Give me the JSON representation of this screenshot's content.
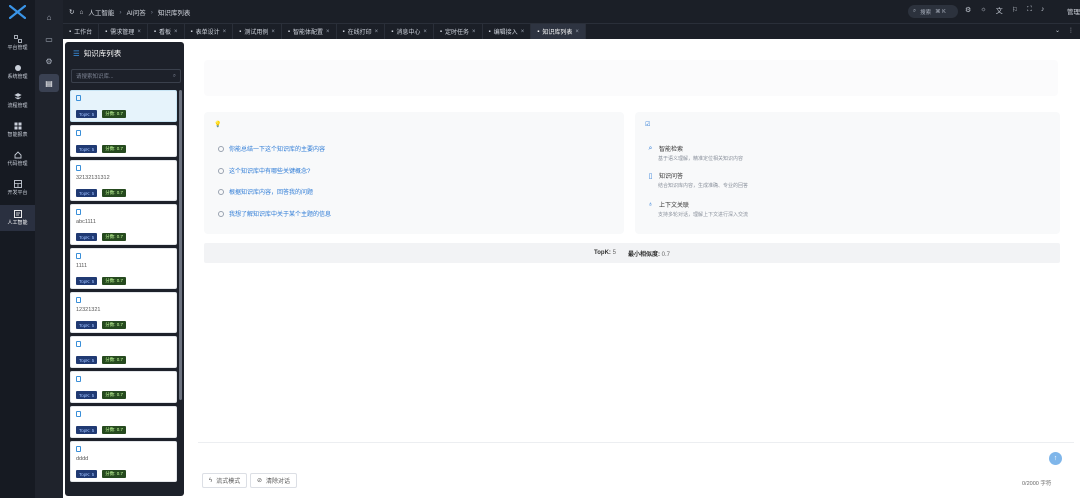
{
  "nav": {
    "items": [
      {
        "label": "平台管理",
        "icon": "platform-icon"
      },
      {
        "label": "系统管理",
        "icon": "system-icon"
      },
      {
        "label": "流程管理",
        "icon": "flow-icon"
      },
      {
        "label": "智能报表",
        "icon": "report-icon"
      },
      {
        "label": "代码管理",
        "icon": "code-icon"
      },
      {
        "label": "开发平台",
        "icon": "dev-icon"
      },
      {
        "label": "人工智能",
        "icon": "ai-icon"
      }
    ]
  },
  "breadcrumb": {
    "home": "⌂",
    "level1": "人工智能",
    "level2": "AI问答",
    "level3": "知识库列表"
  },
  "topbar": {
    "search_placeholder": "搜索",
    "search_shortcut": "⌘ K",
    "user": "管理"
  },
  "tabs": [
    {
      "label": "工作台",
      "active": false
    },
    {
      "label": "需求管理",
      "active": false
    },
    {
      "label": "看板",
      "active": false
    },
    {
      "label": "表单设计",
      "active": false
    },
    {
      "label": "测试用例",
      "active": false
    },
    {
      "label": "智能体配置",
      "active": false
    },
    {
      "label": "在线打印",
      "active": false
    },
    {
      "label": "消息中心",
      "active": false
    },
    {
      "label": "定时任务",
      "active": false
    },
    {
      "label": "编辑接入",
      "active": false
    },
    {
      "label": "知识库列表",
      "active": true
    }
  ],
  "knowledge_panel": {
    "title": "知识库列表",
    "search_placeholder": "请搜索知识库...",
    "items": [
      {
        "name": "",
        "topk": "TopK: 5",
        "score": "分数: 0.7",
        "selected": true
      },
      {
        "name": "",
        "topk": "TopK: 5",
        "score": "分数: 0.7",
        "selected": false
      },
      {
        "name": "32132131312",
        "topk": "TopK: 5",
        "score": "分数: 0.7",
        "selected": false
      },
      {
        "name": "abc1111",
        "topk": "TopK: 5",
        "score": "分数: 0.7",
        "selected": false
      },
      {
        "name": "1111",
        "topk": "TopK: 5",
        "score": "分数: 0.7",
        "selected": false
      },
      {
        "name": "12321321",
        "topk": "TopK: 5",
        "score": "分数: 0.7",
        "selected": false
      },
      {
        "name": "",
        "topk": "TopK: 5",
        "score": "分数: 0.7",
        "selected": false
      },
      {
        "name": "",
        "topk": "TopK: 5",
        "score": "分数: 0.7",
        "selected": false
      },
      {
        "name": "",
        "topk": "TopK: 5",
        "score": "分数: 0.7",
        "selected": false
      },
      {
        "name": "dddd",
        "topk": "TopK: 5",
        "score": "分数: 0.7",
        "selected": false
      }
    ]
  },
  "main": {
    "questions": [
      "你能总结一下这个知识库的主要内容",
      "这个知识库中有哪些关键概念?",
      "根据知识库内容，回答我的问题",
      "我想了解知识库中关于某个主题的信息"
    ],
    "features": [
      {
        "title": "智能检索",
        "desc": "基于语义理解，精准定位相关知识内容",
        "icon": "search-icon"
      },
      {
        "title": "知识问答",
        "desc": "结合知识库内容，生成准确、专业的回答",
        "icon": "document-icon"
      },
      {
        "title": "上下文关联",
        "desc": "支持多轮对话，理解上下文进行深入交流",
        "icon": "lightbulb-icon"
      }
    ],
    "stats": {
      "topk_label": "TopK:",
      "topk_value": "5",
      "score_label": "最小相似度:",
      "score_value": "0.7"
    },
    "buttons": {
      "stream": "流式模式",
      "clear": "清除对话"
    },
    "counter": "0/2000 字符"
  },
  "colors": {
    "accent": "#2d7bd6",
    "rail": "#161a22",
    "panel": "#1d212a"
  }
}
